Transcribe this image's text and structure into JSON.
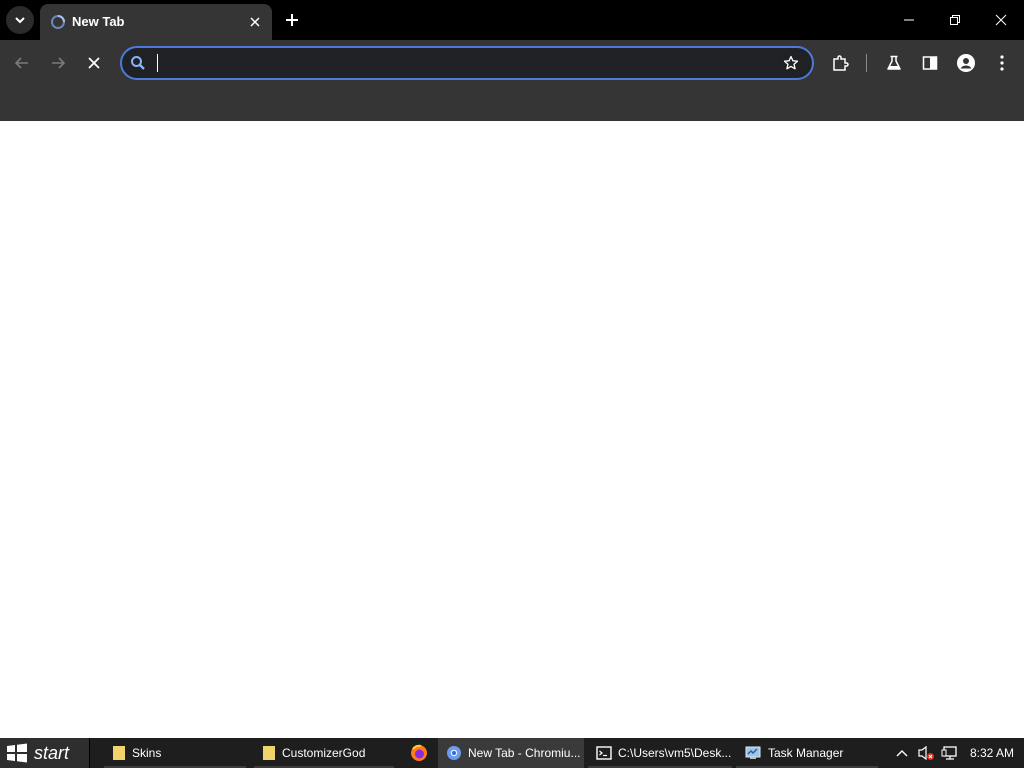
{
  "browser": {
    "tab": {
      "title": "New Tab"
    },
    "omnibox": {
      "value": "",
      "placeholder": ""
    }
  },
  "taskbar": {
    "start_label": "start",
    "tasks": [
      {
        "label": "Skins"
      },
      {
        "label": "CustomizerGod"
      },
      {
        "label": ""
      },
      {
        "label": "New Tab - Chromiu..."
      },
      {
        "label": "C:\\Users\\vm5\\Desk..."
      },
      {
        "label": "Task Manager"
      }
    ],
    "clock": "8:32 AM"
  },
  "colors": {
    "accent": "#4c7ad8",
    "toolbar": "#353535",
    "titlebar": "#000000"
  }
}
